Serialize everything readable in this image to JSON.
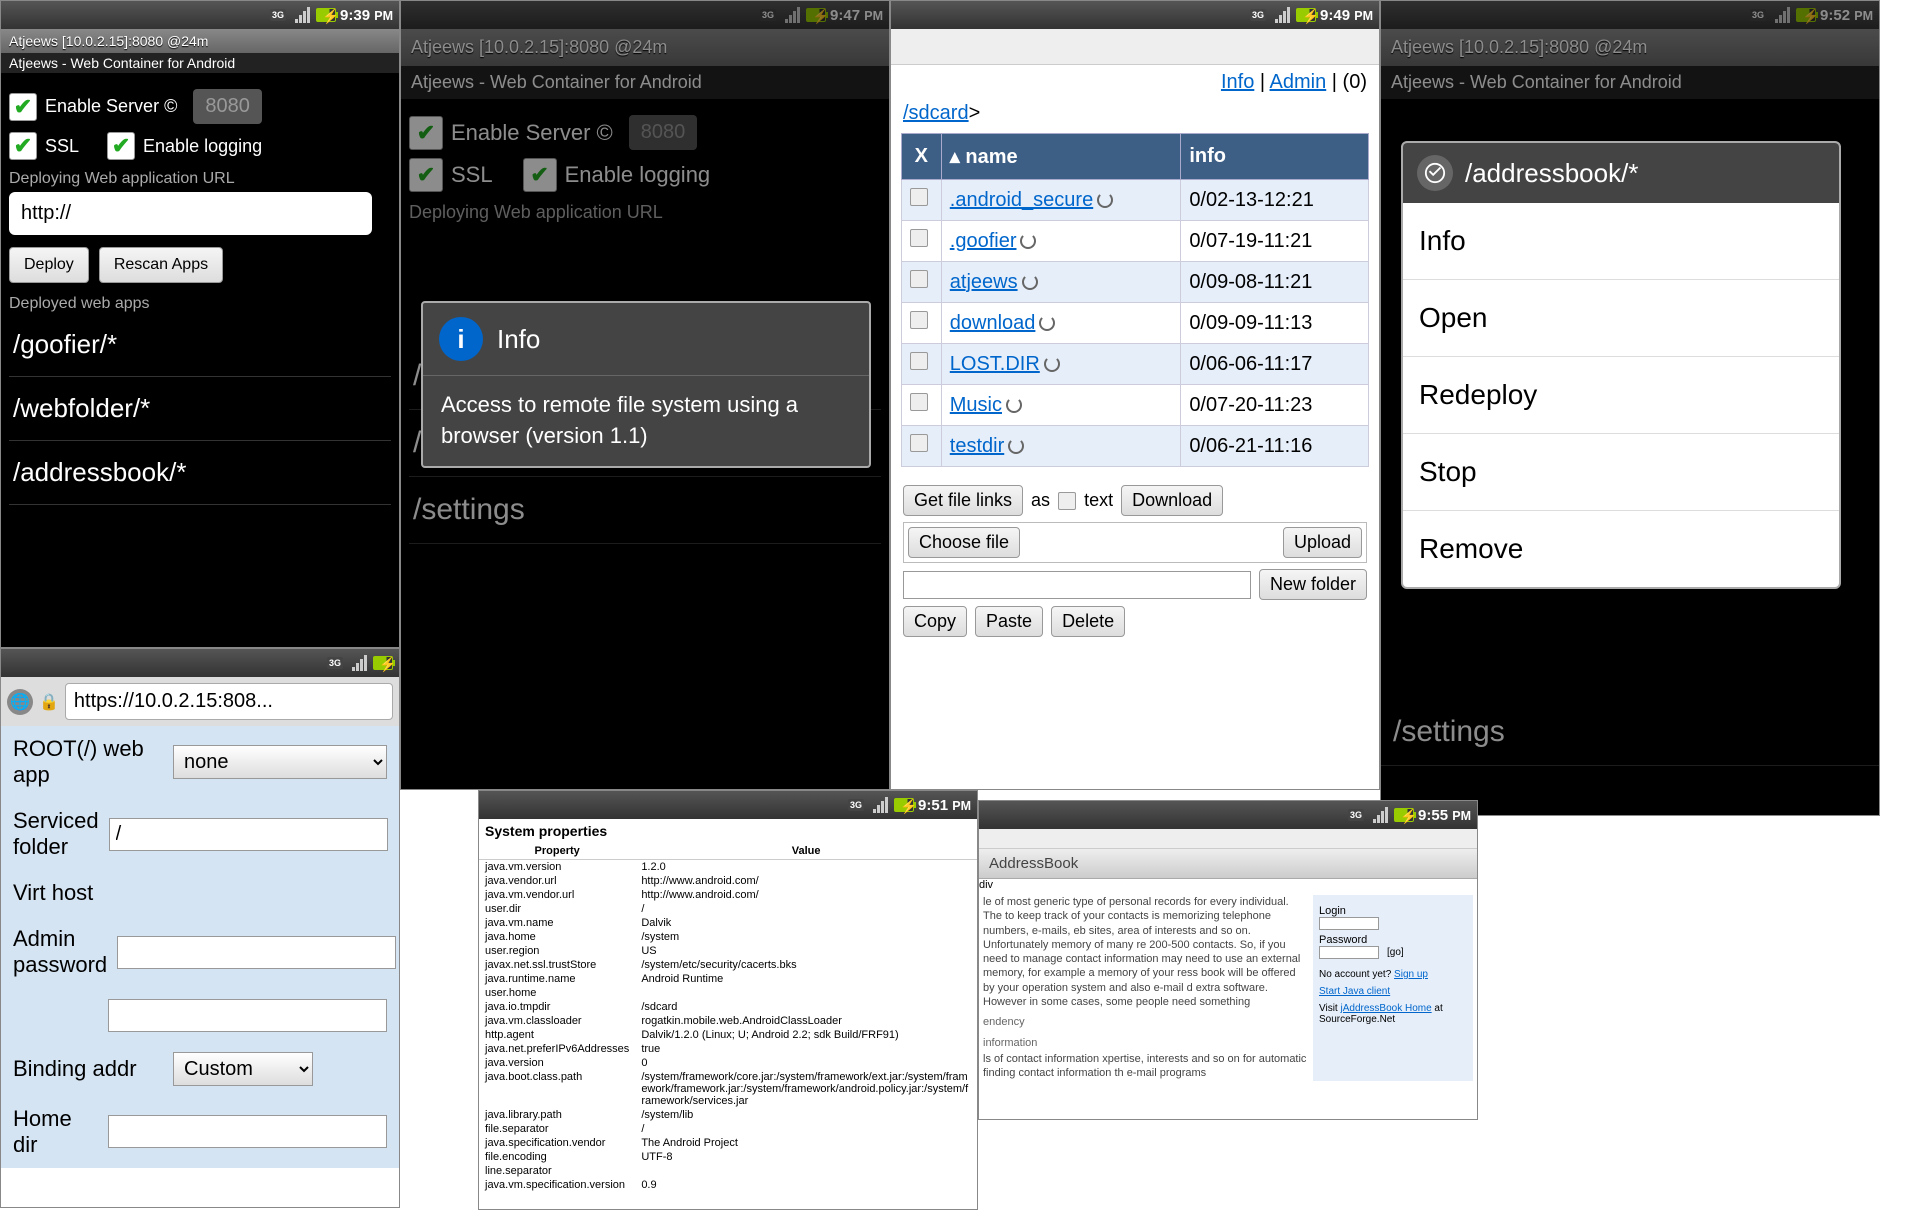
{
  "statusbar": {
    "times": [
      "9:39",
      "9:47",
      "9:49",
      "9:52",
      "9:51",
      "9:55"
    ],
    "pm": "PM"
  },
  "app": {
    "title": "Atjeews [10.0.2.15]:8080 @24m",
    "subtitle": "Atjeews - Web Container for Android"
  },
  "main": {
    "enable_server": "Enable Server ©",
    "port": "8080",
    "ssl": "SSL",
    "enable_logging": "Enable logging",
    "deploy_url_label": "Deploying Web application URL",
    "deploy_url_value": "http://",
    "deploy_btn": "Deploy",
    "rescan_btn": "Rescan Apps",
    "deployed_label": "Deployed web apps",
    "apps": [
      "/goofier/*",
      "/webfolder/*",
      "/addressbook/*",
      "/settings"
    ]
  },
  "info_dialog": {
    "title": "Info",
    "body": "Access to remote file system using a browser (version 1.1)"
  },
  "ctx_menu": {
    "title": "/addressbook/*",
    "items": [
      "Info",
      "Open",
      "Redeploy",
      "Stop",
      "Remove"
    ]
  },
  "file_browser": {
    "links": {
      "info": "Info",
      "admin": "Admin",
      "count": "(0)"
    },
    "crumb": "/sdcard",
    "crumb_suffix": ">",
    "cols": {
      "x": "X",
      "name": "name",
      "info": "info"
    },
    "rows": [
      {
        "name": ".android_secure",
        "info": "0/02-13-12:21"
      },
      {
        "name": ".goofier",
        "info": "0/07-19-11:21"
      },
      {
        "name": "atjeews",
        "info": "0/09-08-11:21"
      },
      {
        "name": "download",
        "info": "0/09-09-11:13"
      },
      {
        "name": "LOST.DIR",
        "info": "0/06-06-11:17"
      },
      {
        "name": "Music",
        "info": "0/07-20-11:23"
      },
      {
        "name": "testdir",
        "info": "0/06-21-11:16"
      }
    ],
    "btns": {
      "get_links": "Get file links",
      "as": "as",
      "text": "text",
      "download": "Download",
      "choose": "Choose file",
      "upload": "Upload",
      "new_folder": "New folder",
      "copy": "Copy",
      "paste": "Paste",
      "delete": "Delete"
    }
  },
  "settings": {
    "url": "https://10.0.2.15:808...",
    "root_label": "ROOT(/) web app",
    "root_value": "none",
    "serviced_label": "Serviced folder",
    "serviced_value": "/",
    "virt_label": "Virt host",
    "admin_label": "Admin password",
    "binding_label": "Binding addr",
    "binding_value": "Custom",
    "home_label": "Home dir"
  },
  "sysprops": {
    "title": "System properties",
    "col1": "Property",
    "col2": "Value",
    "rows": [
      [
        "java.vm.version",
        "1.2.0"
      ],
      [
        "java.vendor.url",
        "http://www.android.com/"
      ],
      [
        "java.vm.vendor.url",
        "http://www.android.com/"
      ],
      [
        "user.dir",
        "/"
      ],
      [
        "java.vm.name",
        "Dalvik"
      ],
      [
        "java.home",
        "/system"
      ],
      [
        "user.region",
        "US"
      ],
      [
        "javax.net.ssl.trustStore",
        "/system/etc/security/cacerts.bks"
      ],
      [
        "java.runtime.name",
        "Android Runtime"
      ],
      [
        "user.home",
        ""
      ],
      [
        "java.io.tmpdir",
        "/sdcard"
      ],
      [
        "java.vm.classloader",
        "rogatkin.mobile.web.AndroidClassLoader"
      ],
      [
        "http.agent",
        "Dalvik/1.2.0 (Linux; U; Android 2.2; sdk Build/FRF91)"
      ],
      [
        "java.net.preferIPv6Addresses",
        "true"
      ],
      [
        "java.version",
        "0"
      ],
      [
        "java.boot.class.path",
        "/system/framework/core.jar:/system/framework/ext.jar:/system/framework/framework.jar:/system/framework/android.policy.jar:/system/framework/services.jar"
      ],
      [
        "java.library.path",
        "/system/lib"
      ],
      [
        "file.separator",
        "/"
      ],
      [
        "java.specification.vendor",
        "The Android Project"
      ],
      [
        "file.encoding",
        "UTF-8"
      ],
      [
        "line.separator",
        ""
      ],
      [
        "java.vm.specification.version",
        "0.9"
      ]
    ]
  },
  "abook": {
    "title": "AddressBook",
    "desc1": "le of most generic type of personal records for every individual. The to keep track of your contacts is memorizing telephone numbers, e-mails, eb sites, area of interests and so on. Unfortunately memory of many re 200-500 contacts. So, if you need to manage contact information may need to use an external memory, for example a memory of your ress book will be offered by your operation system and also e-mail d extra software. However in some cases, some people need something",
    "h1": "endency",
    "h2": "information",
    "desc2": "ls of contact information xpertise, interests and so on for automatic finding contact information th e-mail programs",
    "login": "Login",
    "password": "Password",
    "go": "[go]",
    "noacct": "No account yet? ",
    "signup": "Sign up",
    "startjava": "Start Java client",
    "visit": "Visit ",
    "home": "jAddressBook Home",
    "at": " at SourceForge.Net"
  }
}
